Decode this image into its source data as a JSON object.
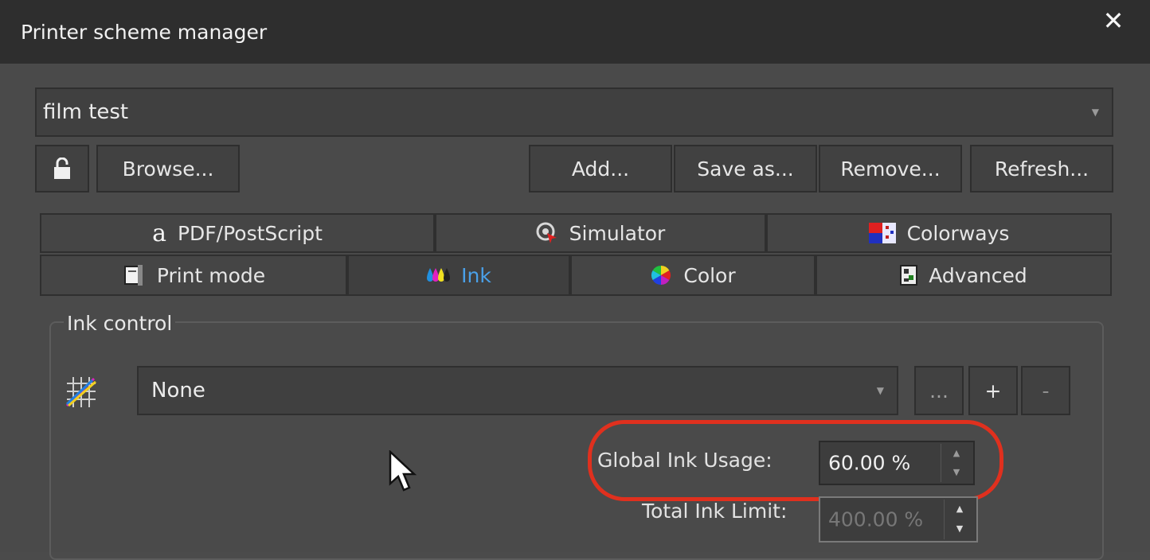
{
  "window": {
    "title": "Printer scheme manager",
    "close_glyph": "✕"
  },
  "scheme": {
    "selected": "film test"
  },
  "toolbar": {
    "lock_icon": "unlock-icon",
    "browse_label": "Browse...",
    "add_label": "Add...",
    "save_as_label": "Save as...",
    "remove_label": "Remove...",
    "refresh_label": "Refresh..."
  },
  "tabs": {
    "row1": [
      {
        "label": "PDF/PostScript",
        "icon": "pdf-postscript-icon"
      },
      {
        "label": "Simulator",
        "icon": "simulator-icon"
      },
      {
        "label": "Colorways",
        "icon": "colorways-icon"
      }
    ],
    "row2": [
      {
        "label": "Print mode",
        "icon": "print-mode-icon"
      },
      {
        "label": "Ink",
        "icon": "ink-drops-icon",
        "active": true
      },
      {
        "label": "Color",
        "icon": "color-wheel-icon"
      },
      {
        "label": "Advanced",
        "icon": "advanced-icon"
      }
    ]
  },
  "ink_control": {
    "legend": "Ink control",
    "curve_icon": "ink-curve-icon",
    "curve_selected": "None",
    "more_label": "...",
    "plus_label": "+",
    "minus_label": "-",
    "global_ink_label": "Global Ink Usage:",
    "global_ink_value": "60.00 %",
    "total_ink_label": "Total Ink Limit:",
    "total_ink_value": "400.00 %"
  },
  "colors": {
    "accent": "#4aa0e8",
    "highlight": "#e0301e"
  }
}
